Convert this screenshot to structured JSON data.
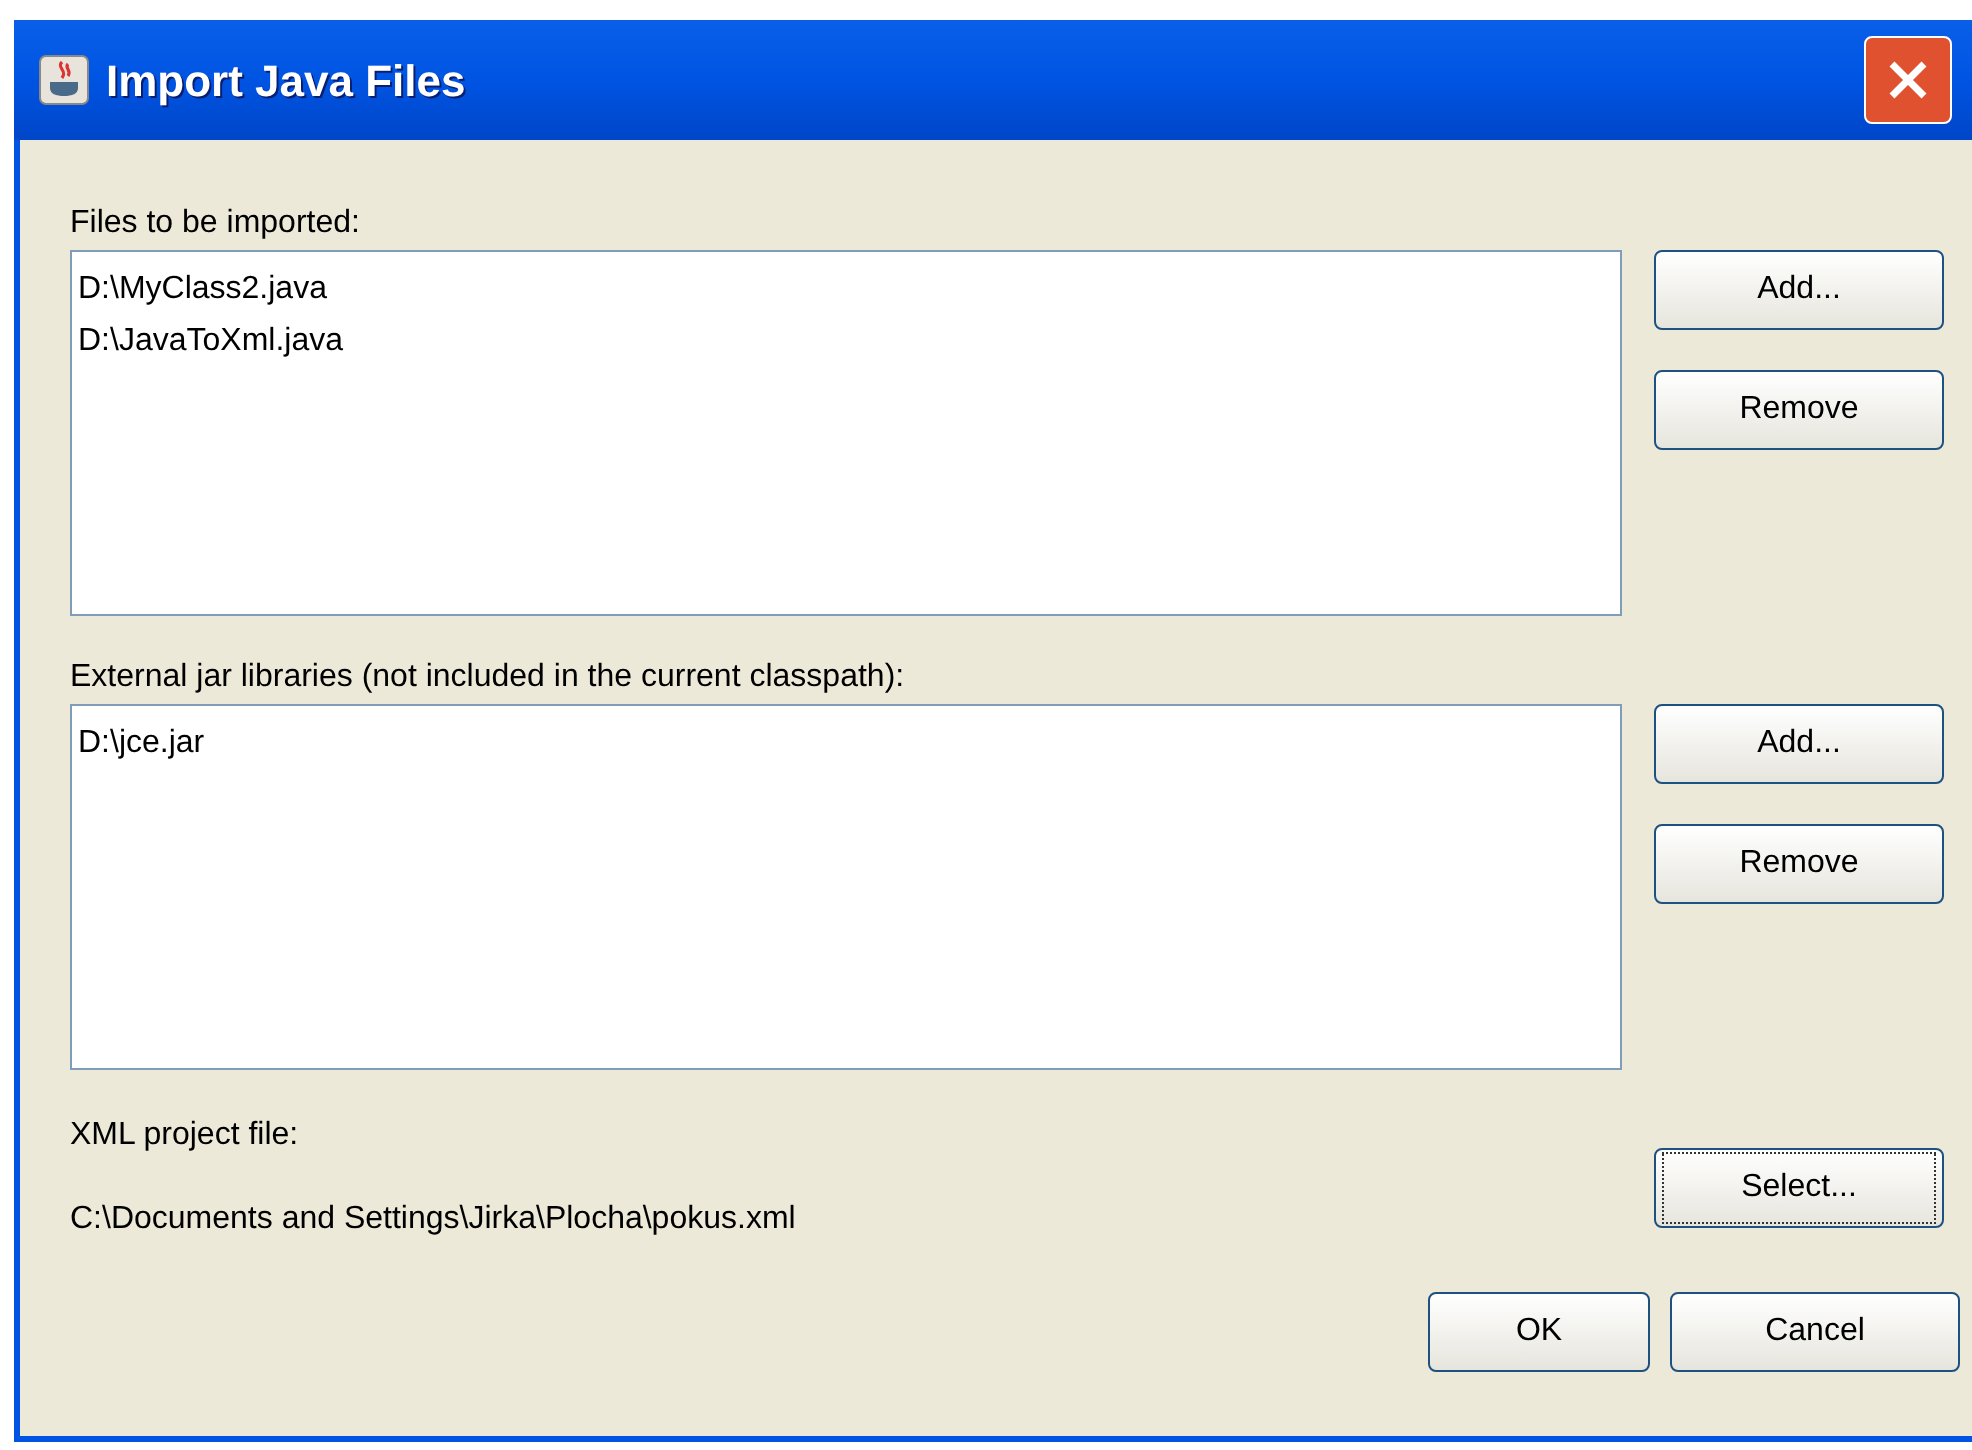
{
  "window": {
    "title": "Import Java Files"
  },
  "files_section": {
    "label": "Files to be imported:",
    "items": [
      "D:\\MyClass2.java",
      "D:\\JavaToXml.java"
    ],
    "buttons": [
      {
        "label": "Add...",
        "focused": false
      },
      {
        "label": "Remove",
        "focused": false
      }
    ]
  },
  "jars_section": {
    "label": "External jar libraries (not included in the current classpath):",
    "items": [
      "D:\\jce.jar"
    ],
    "buttons": [
      {
        "label": "Add...",
        "focused": false
      },
      {
        "label": "Remove",
        "focused": false
      }
    ]
  },
  "project_section": {
    "label": "XML project file:",
    "path": "C:\\Documents and Settings\\Jirka\\Plocha\\pokus.xml",
    "button": {
      "label": "Select...",
      "focused": true
    }
  },
  "footer_buttons": [
    {
      "label": "OK",
      "focused": false
    },
    {
      "label": "Cancel",
      "focused": false
    }
  ]
}
